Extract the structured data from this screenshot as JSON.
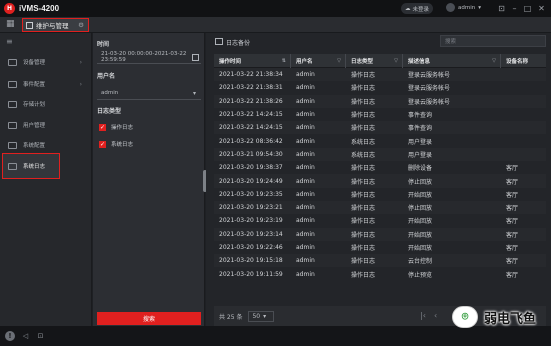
{
  "app": {
    "title": "iVMS-4200",
    "logo_letter": "H"
  },
  "titlebar": {
    "cloud_status": "未登录",
    "username": "admin"
  },
  "tabs": {
    "active_label": "维护与管理"
  },
  "nav": {
    "items": [
      {
        "label": "设备管理",
        "has_arrow": true
      },
      {
        "label": "事件配置",
        "has_arrow": true
      },
      {
        "label": "存储计划",
        "has_arrow": false
      },
      {
        "label": "用户管理",
        "has_arrow": false
      },
      {
        "label": "系统配置",
        "has_arrow": false
      },
      {
        "label": "系统日志",
        "has_arrow": false
      }
    ]
  },
  "filter": {
    "time_label": "时间",
    "time_value": "21-03-20 00:00:00-2021-03-22 23:59:59",
    "user_label": "用户名",
    "user_value": "admin",
    "type_label": "日志类型",
    "types": [
      "操作日志",
      "系统日志"
    ],
    "search_button": "搜索"
  },
  "main": {
    "backup_label": "日志备份",
    "search_placeholder": "搜索",
    "columns": [
      "操作时间",
      "用户名",
      "日志类型",
      "描述信息",
      "设备名称"
    ],
    "rows": [
      [
        "2021-03-22 21:38:34",
        "admin",
        "操作日志",
        "登录云服务帐号",
        ""
      ],
      [
        "2021-03-22 21:38:31",
        "admin",
        "操作日志",
        "登录云服务帐号",
        ""
      ],
      [
        "2021-03-22 21:38:26",
        "admin",
        "操作日志",
        "登录云服务帐号",
        ""
      ],
      [
        "2021-03-22 14:24:15",
        "admin",
        "操作日志",
        "事件查询",
        ""
      ],
      [
        "2021-03-22 14:24:15",
        "admin",
        "操作日志",
        "事件查询",
        ""
      ],
      [
        "2021-03-22 08:36:42",
        "admin",
        "系统日志",
        "用户登录",
        ""
      ],
      [
        "2021-03-21 09:54:30",
        "admin",
        "系统日志",
        "用户登录",
        ""
      ],
      [
        "2021-03-20 19:38:37",
        "admin",
        "操作日志",
        "删除设备",
        "客厅"
      ],
      [
        "2021-03-20 19:24:49",
        "admin",
        "操作日志",
        "停止回放",
        "客厅"
      ],
      [
        "2021-03-20 19:23:35",
        "admin",
        "操作日志",
        "开始回放",
        "客厅"
      ],
      [
        "2021-03-20 19:23:21",
        "admin",
        "操作日志",
        "停止回放",
        "客厅"
      ],
      [
        "2021-03-20 19:23:19",
        "admin",
        "操作日志",
        "开始回放",
        "客厅"
      ],
      [
        "2021-03-20 19:23:14",
        "admin",
        "操作日志",
        "开始回放",
        "客厅"
      ],
      [
        "2021-03-20 19:22:46",
        "admin",
        "操作日志",
        "开始回放",
        "客厅"
      ],
      [
        "2021-03-20 19:15:18",
        "admin",
        "操作日志",
        "云台控制",
        "客厅"
      ],
      [
        "2021-03-20 19:11:59",
        "admin",
        "操作日志",
        "停止预览",
        "客厅"
      ]
    ],
    "total_text": "共 25 条",
    "page_size": "50"
  },
  "watermark": {
    "text": "弱电飞鱼"
  },
  "colors": {
    "accent": "#e0201f",
    "bg": "#1e2024",
    "panel": "#2c2e33"
  }
}
